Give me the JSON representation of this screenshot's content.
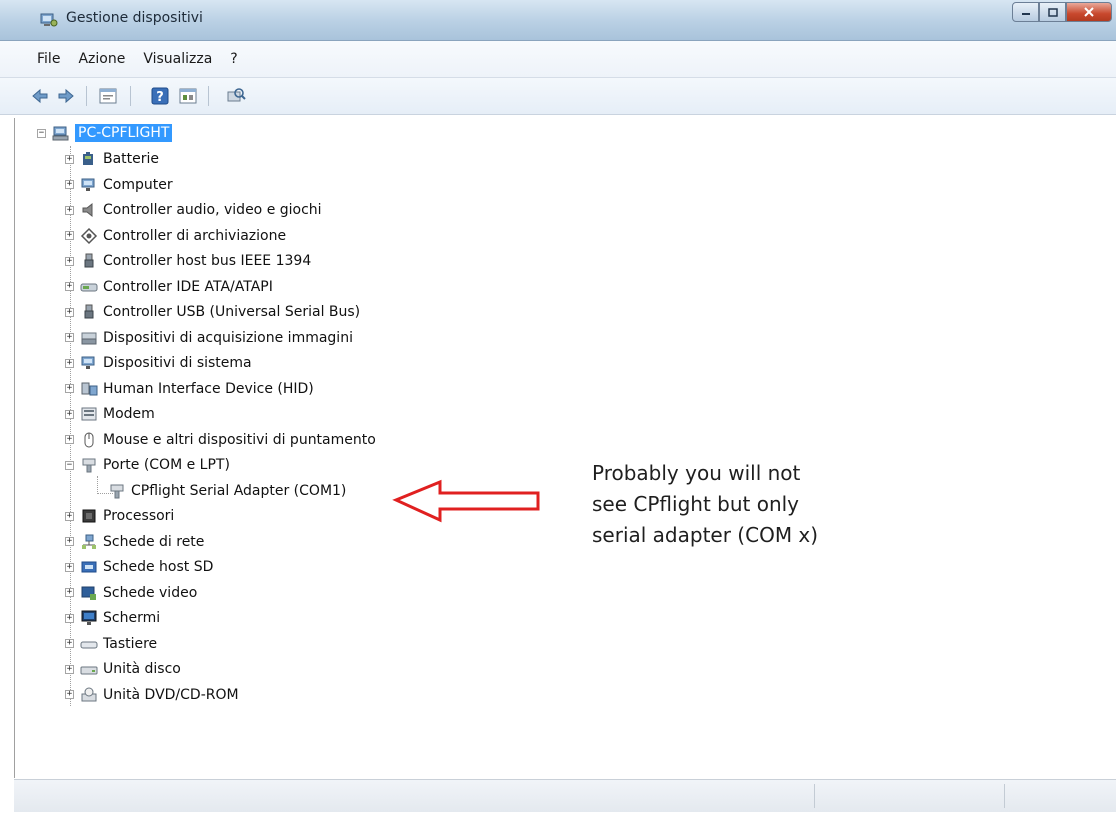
{
  "window": {
    "title": "Gestione dispositivi"
  },
  "menu": [
    "File",
    "Azione",
    "Visualizza",
    "?"
  ],
  "toolbar": [
    "back-arrow-icon",
    "forward-arrow-icon",
    "properties-icon",
    "help-icon",
    "details-icon",
    "scan-hardware-icon"
  ],
  "tree": {
    "root": "PC-CPFLIGHT",
    "items": [
      {
        "label": "Batterie",
        "icon": "battery-icon"
      },
      {
        "label": "Computer",
        "icon": "computer-icon"
      },
      {
        "label": "Controller audio, video e giochi",
        "icon": "speaker-icon"
      },
      {
        "label": "Controller di archiviazione",
        "icon": "storage-icon"
      },
      {
        "label": "Controller host bus IEEE 1394",
        "icon": "usb-plug-icon"
      },
      {
        "label": "Controller IDE ATA/ATAPI",
        "icon": "ide-icon"
      },
      {
        "label": "Controller USB (Universal Serial Bus)",
        "icon": "usb-plug-icon"
      },
      {
        "label": "Dispositivi di acquisizione immagini",
        "icon": "scanner-icon"
      },
      {
        "label": "Dispositivi di sistema",
        "icon": "computer-icon"
      },
      {
        "label": "Human Interface Device (HID)",
        "icon": "hid-icon"
      },
      {
        "label": "Modem",
        "icon": "modem-icon"
      },
      {
        "label": "Mouse e altri dispositivi di puntamento",
        "icon": "mouse-icon"
      },
      {
        "label": "Porte (COM e LPT)",
        "icon": "port-icon",
        "expanded": true
      },
      {
        "label": "CPflight Serial Adapter (COM1)",
        "icon": "port-icon",
        "child": true
      },
      {
        "label": "Processori",
        "icon": "processor-icon"
      },
      {
        "label": "Schede di rete",
        "icon": "network-icon"
      },
      {
        "label": "Schede host SD",
        "icon": "sd-card-icon"
      },
      {
        "label": "Schede video",
        "icon": "display-adapter-icon"
      },
      {
        "label": "Schermi",
        "icon": "monitor-icon"
      },
      {
        "label": "Tastiere",
        "icon": "keyboard-icon"
      },
      {
        "label": "Unità disco",
        "icon": "disk-drive-icon"
      },
      {
        "label": "Unità DVD/CD-ROM",
        "icon": "dvd-icon"
      }
    ]
  },
  "annotation": {
    "lines": [
      "Probably you will not",
      "see CPflight but only",
      "serial adapter (COM x)"
    ],
    "arrow_color": "#e02020"
  }
}
